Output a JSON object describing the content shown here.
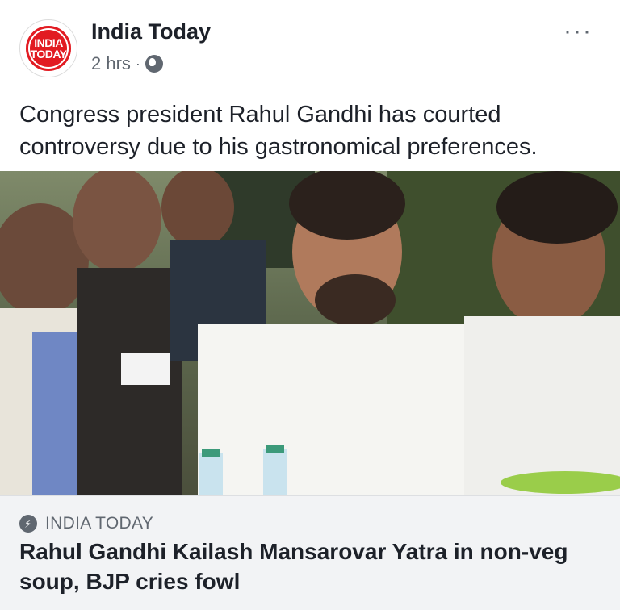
{
  "post": {
    "page_name": "India Today",
    "logo_line1": "INDIA",
    "logo_line2": "TODAY",
    "time": "2 hrs",
    "separator": "·",
    "more_label": "···",
    "privacy_icon": "globe-icon",
    "text": "Congress president Rahul Gandhi has courted controversy due to his gastronomical preferences."
  },
  "link_preview": {
    "source": "INDIA TODAY",
    "source_icon": "lightning-bolt-icon",
    "headline": "Rahul Gandhi Kailash Mansarovar Yatra in non-veg soup, BJP cries fowl"
  },
  "colors": {
    "logo_red": "#e21b22",
    "text_primary": "#1d2129",
    "text_secondary": "#606770",
    "preview_bg": "#f2f3f5"
  }
}
